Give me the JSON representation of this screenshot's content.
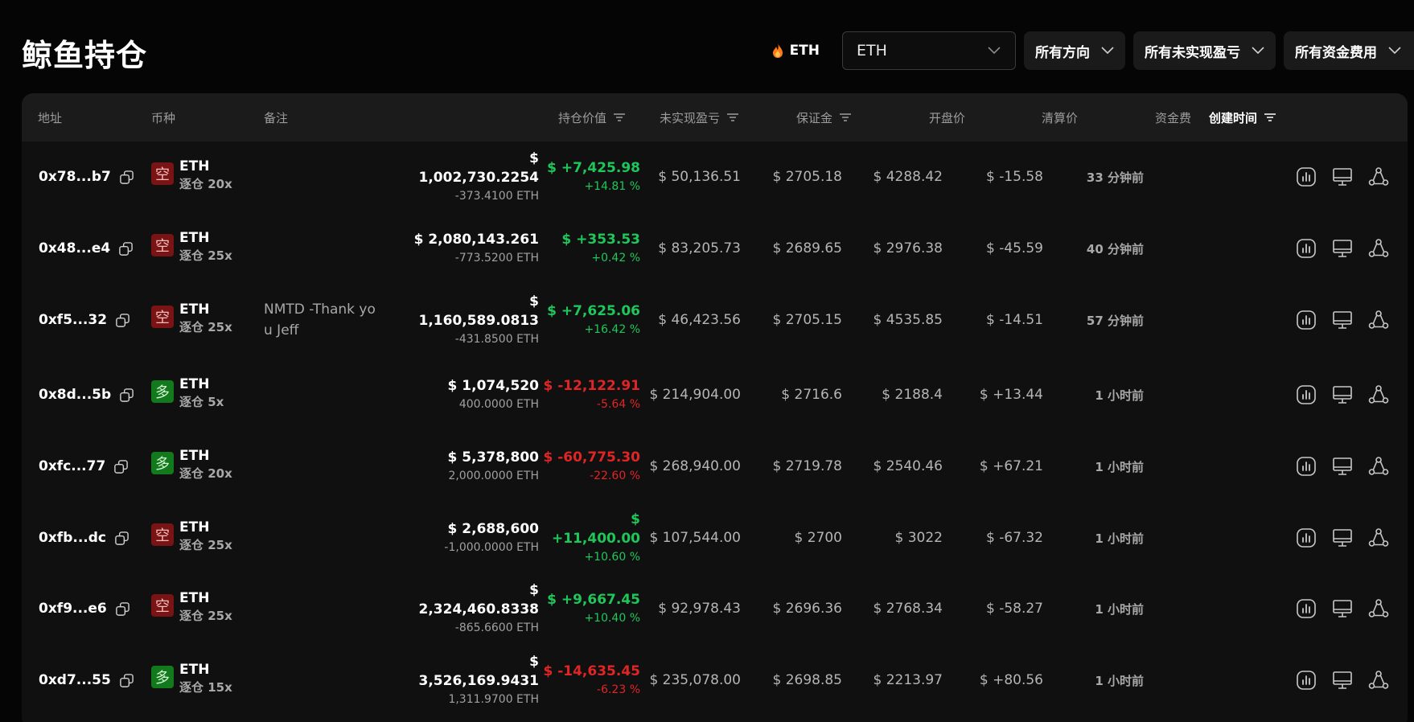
{
  "page_title": "鲸鱼持仓",
  "filters": {
    "hot_token": "ETH",
    "token_select": "ETH",
    "direction": "所有方向",
    "unrealized_pnl": "所有未实现盈亏",
    "funding": "所有资金费用"
  },
  "columns": {
    "address": "地址",
    "coin": "币种",
    "note": "备注",
    "position_value": "持仓价值",
    "unrealized_pnl": "未实现盈亏",
    "margin": "保证金",
    "open_price": "开盘价",
    "liq_price": "清算价",
    "funding": "资金费",
    "created": "创建时间"
  },
  "colors": {
    "positive": "#1fc75a",
    "negative": "#e02525",
    "short_badge": "#7a1414",
    "long_badge": "#127a1c"
  },
  "rows": [
    {
      "address": "0x78...b7",
      "direction": "空",
      "side": "short",
      "coin": "ETH",
      "leverage": "逐仓 20x",
      "note": "",
      "value": "$ 1,002,730.2254",
      "size": "-373.4100 ETH",
      "pnl": "$ +7,425.98",
      "pnl_pct": "+14.81 %",
      "pnl_sign": "pos",
      "margin": "$ 50,136.51",
      "open": "$ 2705.18",
      "liq": "$ 4288.42",
      "funding": "$ -15.58",
      "funding_sign": "neg",
      "created": "33 分钟前"
    },
    {
      "address": "0x48...e4",
      "direction": "空",
      "side": "short",
      "coin": "ETH",
      "leverage": "逐仓 25x",
      "note": "",
      "value": "$ 2,080,143.261",
      "size": "-773.5200 ETH",
      "pnl": "$ +353.53",
      "pnl_pct": "+0.42 %",
      "pnl_sign": "pos",
      "margin": "$ 83,205.73",
      "open": "$ 2689.65",
      "liq": "$ 2976.38",
      "funding": "$ -45.59",
      "funding_sign": "neg",
      "created": "40 分钟前"
    },
    {
      "address": "0xf5...32",
      "direction": "空",
      "side": "short",
      "coin": "ETH",
      "leverage": "逐仓 25x",
      "note": "NMTD -Thank you Jeff",
      "value": "$ 1,160,589.0813",
      "size": "-431.8500 ETH",
      "pnl": "$ +7,625.06",
      "pnl_pct": "+16.42 %",
      "pnl_sign": "pos",
      "margin": "$ 46,423.56",
      "open": "$ 2705.15",
      "liq": "$ 4535.85",
      "funding": "$ -14.51",
      "funding_sign": "neg",
      "created": "57 分钟前"
    },
    {
      "address": "0x8d...5b",
      "direction": "多",
      "side": "long",
      "coin": "ETH",
      "leverage": "逐仓 5x",
      "note": "",
      "value": "$ 1,074,520",
      "size": "400.0000 ETH",
      "pnl": "$ -12,122.91",
      "pnl_pct": "-5.64 %",
      "pnl_sign": "neg",
      "margin": "$ 214,904.00",
      "open": "$ 2716.6",
      "liq": "$ 2188.4",
      "funding": "$ +13.44",
      "funding_sign": "pos",
      "created": "1 小时前"
    },
    {
      "address": "0xfc...77",
      "direction": "多",
      "side": "long",
      "coin": "ETH",
      "leverage": "逐仓 20x",
      "note": "",
      "value": "$ 5,378,800",
      "size": "2,000.0000 ETH",
      "pnl": "$ -60,775.30",
      "pnl_pct": "-22.60 %",
      "pnl_sign": "neg",
      "margin": "$ 268,940.00",
      "open": "$ 2719.78",
      "liq": "$ 2540.46",
      "funding": "$ +67.21",
      "funding_sign": "pos",
      "created": "1 小时前"
    },
    {
      "address": "0xfb...dc",
      "direction": "空",
      "side": "short",
      "coin": "ETH",
      "leverage": "逐仓 25x",
      "note": "",
      "value": "$ 2,688,600",
      "size": "-1,000.0000 ETH",
      "pnl": "$ +11,400.00",
      "pnl_pct": "+10.60 %",
      "pnl_sign": "pos",
      "margin": "$ 107,544.00",
      "open": "$ 2700",
      "liq": "$ 3022",
      "funding": "$ -67.32",
      "funding_sign": "neg",
      "created": "1 小时前"
    },
    {
      "address": "0xf9...e6",
      "direction": "空",
      "side": "short",
      "coin": "ETH",
      "leverage": "逐仓 25x",
      "note": "",
      "value": "$ 2,324,460.8338",
      "size": "-865.6600 ETH",
      "pnl": "$ +9,667.45",
      "pnl_pct": "+10.40 %",
      "pnl_sign": "pos",
      "margin": "$ 92,978.43",
      "open": "$ 2696.36",
      "liq": "$ 2768.34",
      "funding": "$ -58.27",
      "funding_sign": "neg",
      "created": "1 小时前"
    },
    {
      "address": "0xd7...55",
      "direction": "多",
      "side": "long",
      "coin": "ETH",
      "leverage": "逐仓 15x",
      "note": "",
      "value": "$ 3,526,169.9431",
      "size": "1,311.9700 ETH",
      "pnl": "$ -14,635.45",
      "pnl_pct": "-6.23 %",
      "pnl_sign": "neg",
      "margin": "$ 235,078.00",
      "open": "$ 2698.85",
      "liq": "$ 2213.97",
      "funding": "$ +80.56",
      "funding_sign": "pos",
      "created": "1 小时前"
    }
  ],
  "row_actions": [
    "chart-icon",
    "monitor-icon",
    "share-icon"
  ]
}
